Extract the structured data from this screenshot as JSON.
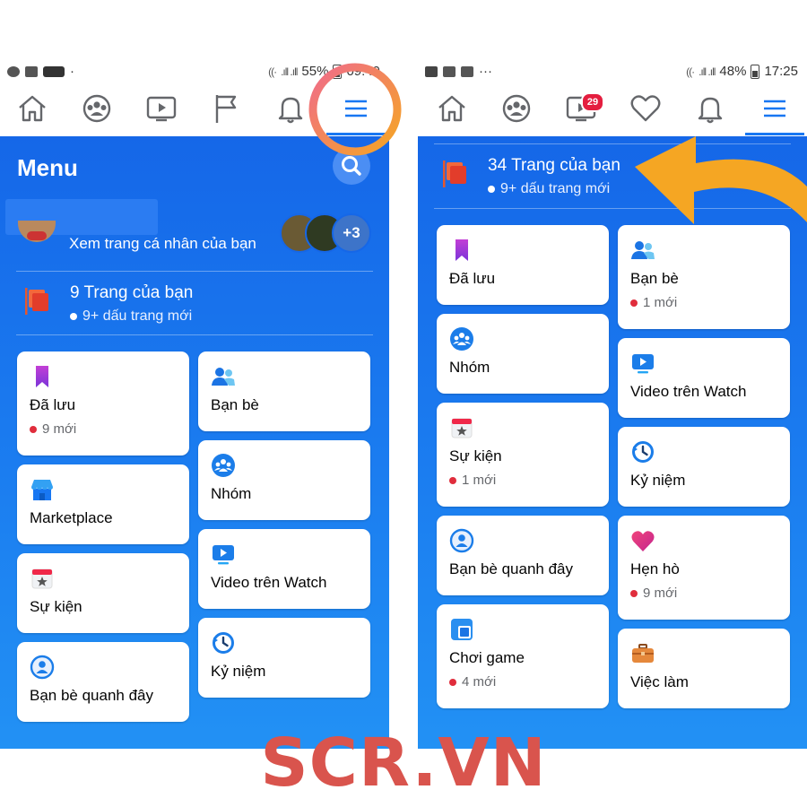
{
  "left": {
    "status": {
      "percent": "55%",
      "time": "09:49"
    },
    "menu_title": "Menu",
    "profile_link": "Xem trang cá nhân của bạn",
    "friends_more": "+3",
    "pages": {
      "title": "9 Trang của bạn",
      "sub": "9+ dấu trang mới"
    },
    "col1": [
      {
        "label": "Đã lưu",
        "badge": "9 mới",
        "icon": "bookmark-icon"
      },
      {
        "label": "Marketplace",
        "badge": "",
        "icon": "marketplace-icon"
      },
      {
        "label": "Sự kiện",
        "badge": "",
        "icon": "calendar-icon"
      },
      {
        "label": "Bạn bè quanh đây",
        "badge": "",
        "icon": "nearby-friends-icon"
      }
    ],
    "col2": [
      {
        "label": "Bạn bè",
        "badge": "",
        "icon": "friends-icon"
      },
      {
        "label": "Nhóm",
        "badge": "",
        "icon": "groups-icon"
      },
      {
        "label": "Video trên Watch",
        "badge": "",
        "icon": "watch-icon"
      },
      {
        "label": "Kỷ niệm",
        "badge": "",
        "icon": "memories-icon"
      }
    ]
  },
  "right": {
    "status": {
      "percent": "48%",
      "time": "17:25"
    },
    "watch_badge": "29",
    "pages": {
      "title": "34 Trang của bạn",
      "sub": "9+ dấu trang mới"
    },
    "col1": [
      {
        "label": "Đã lưu",
        "badge": "",
        "icon": "bookmark-icon"
      },
      {
        "label": "Nhóm",
        "badge": "",
        "icon": "groups-icon"
      },
      {
        "label": "Sự kiện",
        "badge": "1 mới",
        "icon": "calendar-icon"
      },
      {
        "label": "Bạn bè quanh đây",
        "badge": "",
        "icon": "nearby-friends-icon"
      },
      {
        "label": "Chơi game",
        "badge": "4 mới",
        "icon": "gaming-icon"
      }
    ],
    "col2": [
      {
        "label": "Bạn bè",
        "badge": "1 mới",
        "icon": "friends-icon"
      },
      {
        "label": "Video trên Watch",
        "badge": "",
        "icon": "watch-icon"
      },
      {
        "label": "Kỷ niệm",
        "badge": "",
        "icon": "memories-icon"
      },
      {
        "label": "Hẹn hò",
        "badge": "9 mới",
        "icon": "dating-icon"
      },
      {
        "label": "Việc làm",
        "badge": "",
        "icon": "jobs-icon"
      }
    ]
  },
  "watermark": "SCR.VN",
  "colors": {
    "fb_blue": "#1877f2",
    "badge_red": "#e02d3c",
    "annotation_orange": "#f5a623",
    "annotation_pink": "#f06b8b",
    "watermark": "#d9544d"
  }
}
